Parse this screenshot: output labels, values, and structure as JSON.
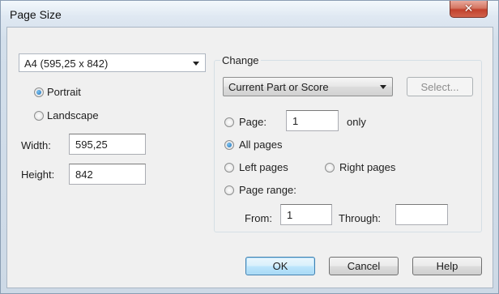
{
  "window": {
    "title": "Page Size",
    "close_glyph": "✕"
  },
  "size_select": {
    "value": "A4 (595,25 x 842)"
  },
  "orientation": {
    "portrait": "Portrait",
    "landscape": "Landscape",
    "selected": "portrait"
  },
  "dimensions": {
    "width_label": "Width:",
    "width_value": "595,25",
    "height_label": "Height:",
    "height_value": "842"
  },
  "change": {
    "label": "Change",
    "scope_select": "Current Part or Score",
    "select_button": "Select...",
    "page_label": "Page:",
    "page_value": "1",
    "only_label": "only",
    "all_pages": "All pages",
    "left_pages": "Left pages",
    "right_pages": "Right pages",
    "page_range": "Page range:",
    "from_label": "From:",
    "from_value": "1",
    "through_label": "Through:",
    "through_value": "",
    "selected": "all_pages"
  },
  "buttons": {
    "ok": "OK",
    "cancel": "Cancel",
    "help": "Help"
  },
  "icons": {
    "close": "close-icon",
    "dropdown": "chevron-down-icon"
  }
}
